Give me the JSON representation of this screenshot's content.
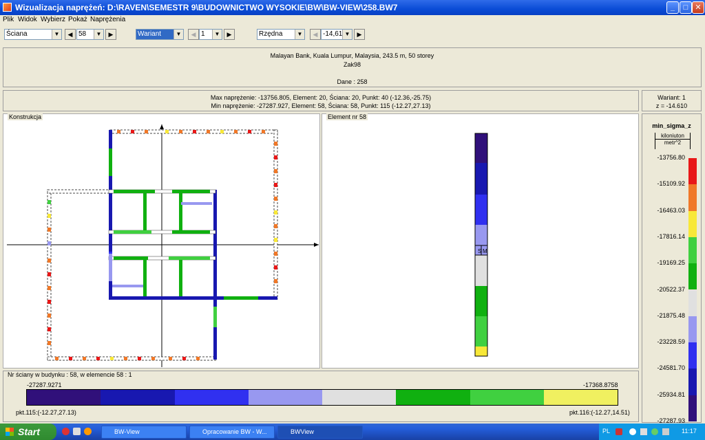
{
  "window": {
    "title": "Wizualizacja naprężeń: D:\\RAVEN\\SEMESTR 9\\BUDOWNICTWO WYSOKIE\\BW\\BW-VIEW\\258.BW7"
  },
  "menu": [
    "Plik",
    "Widok",
    "Wybierz",
    "Pokaż",
    "Naprężenia"
  ],
  "toolbar": {
    "type_select": "Ściana",
    "element_select": "58",
    "mode_select": "Wariant",
    "variant_select": "1",
    "axis_select": "Rzędna",
    "level_select": "-14,61"
  },
  "header": {
    "line1": "Malayan Bank, Kuala Lumpur, Malaysia, 243.5 m, 50 storey",
    "line2": "Zak98",
    "line3": "Dane :   258"
  },
  "stats": {
    "max": "Max naprężenie: -13756.805,   Element: 20,   Ściana: 20,   Punkt: 40 (-12.36,-25.75)",
    "min": "Min naprężenie: -27287.927,   Element: 58,   Ściana: 58,   Punkt: 115 (-12.27,27.13)",
    "variant": "Wariant: 1",
    "z": "z = -14.610"
  },
  "panels": {
    "construction_label": "Konstrukcja",
    "element_label": "Element nr 58",
    "element_marks": [
      "S",
      "M"
    ]
  },
  "legend": {
    "title": "min_sigma_z",
    "unit_num": "kiloniuton",
    "unit_den": "metr^2",
    "values": [
      "-13756.80",
      "-15109.92",
      "-16463.03",
      "-17816.14",
      "-19169.25",
      "-20522.37",
      "-21875.48",
      "-23228.59",
      "-24581.70",
      "-25934.81",
      "-27287.93"
    ],
    "colors": [
      "#e81818",
      "#f07828",
      "#f8e838",
      "#40d040",
      "#10b010",
      "#e0e0e0",
      "#9898f0",
      "#3030f0",
      "#1818b0",
      "#30107a"
    ]
  },
  "bottom": {
    "label": "Nr ściany w budynku :  58,   w elemencie 58 :  1",
    "min_val": "-27287.9271",
    "max_val": "-17368.8758",
    "left_point": "pkt.115:(-12.27,27.13)",
    "right_point": "pkt.116:(-12.27,14.51)",
    "bar_colors": [
      "#30107a",
      "#1818b0",
      "#3030f0",
      "#9898f0",
      "#e0e0e0",
      "#10b010",
      "#40d040",
      "#f0f060"
    ]
  },
  "taskbar": {
    "start": "Start",
    "tasks": [
      "BW-View",
      "Opracowanie BW - W...",
      "BWView"
    ],
    "lang": "PL",
    "clock": "11:17"
  }
}
